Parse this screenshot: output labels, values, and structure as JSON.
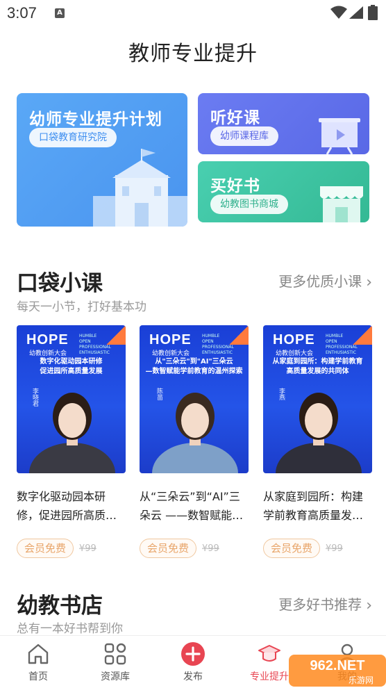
{
  "status_bar": {
    "time": "3:07",
    "notification_icon": "A"
  },
  "page_title": "教师专业提升",
  "cards": {
    "plan": {
      "title": "幼师专业提升计划",
      "pill": "口袋教育研究院",
      "icon": "school-icon"
    },
    "listen": {
      "title": "听好课",
      "pill": "幼师课程库",
      "icon": "projector-icon"
    },
    "book": {
      "title": "买好书",
      "pill": "幼教图书商城",
      "icon": "store-icon"
    }
  },
  "courses_section": {
    "title": "口袋小课",
    "subtitle": "每天一小节，打好基本功",
    "more": "更多优质小课",
    "items": [
      {
        "poster_title": "数字化驱动园本研修\n促进园所高质量发展",
        "poster_name": "李晓君",
        "text": "数字化驱动园本研修，促进园所高质…",
        "tag": "会员免费",
        "price": "¥99"
      },
      {
        "poster_title": "从\"三朵云\"到\"AI\"三朵云\n—数智赋能学前教育的温州探索",
        "poster_name": "陈苗",
        "text": "从“三朵云”到“AI”三朵云 ——数智赋能…",
        "tag": "会员免费",
        "price": "¥99"
      },
      {
        "poster_title": "从家庭到园所：构建学前教育\n高质量发展的共同体",
        "poster_name": "李燕",
        "text": "从家庭到园所：构建学前教育高质量发…",
        "tag": "会员免费",
        "price": "¥99"
      }
    ],
    "logo": "HOPE",
    "logo_sub": "幼教创新大会",
    "logo_en": "HUMBLE OPEN PROFESSIONAL ENTHUSIASTIC"
  },
  "books_section": {
    "title": "幼教书店",
    "subtitle": "总有一本好书帮到你",
    "more": "更多好书推荐"
  },
  "tabbar": {
    "items": [
      {
        "label": "首页",
        "icon": "home-icon"
      },
      {
        "label": "资源库",
        "icon": "grid-icon"
      },
      {
        "label": "发布",
        "icon": "plus-icon"
      },
      {
        "label": "专业提升",
        "icon": "hat-icon",
        "active": true
      },
      {
        "label": "我的",
        "icon": "user-icon"
      }
    ]
  },
  "watermark": {
    "brand": "962.NET",
    "sub": "乐游网"
  },
  "colors": {
    "accent": "#e84552",
    "blue": "#4a94ef",
    "purple": "#5968e6",
    "green": "#34b994",
    "tag": "#e8a56a"
  }
}
